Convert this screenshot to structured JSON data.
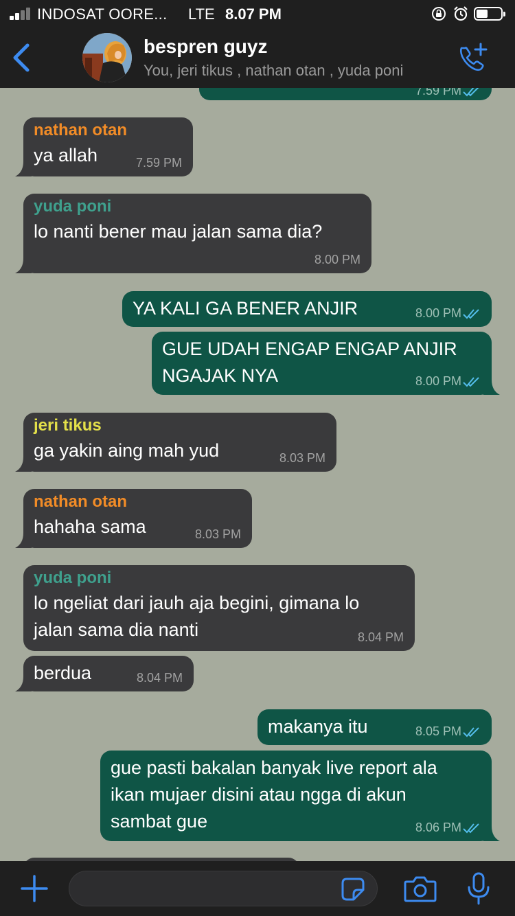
{
  "status_bar": {
    "carrier": "INDOSAT OORE...",
    "network": "LTE",
    "time": "8.07 PM"
  },
  "header": {
    "title": "bespren guyz",
    "subtitle": "You, jeri tikus , nathan otan , yuda poni"
  },
  "colors": {
    "nathan_otan": "#f28c27",
    "yuda_poni": "#3fa08d",
    "jeri_tikus": "#e3e04a",
    "incoming_bubble": "#3a3a3c",
    "outgoing_bubble": "#0f5546",
    "accent_blue": "#3d8bf0"
  },
  "messages": [
    {
      "sender": "",
      "text": "",
      "time": "7.59 PM",
      "outgoing": true,
      "partial": true
    },
    {
      "sender": "nathan otan",
      "text": "ya allah",
      "time": "7.59 PM",
      "outgoing": false
    },
    {
      "sender": "yuda poni",
      "text": "lo nanti bener mau jalan sama dia?",
      "time": "8.00 PM",
      "outgoing": false
    },
    {
      "sender": "",
      "text": "YA KALI GA BENER ANJIR",
      "time": "8.00 PM",
      "outgoing": true
    },
    {
      "sender": "",
      "text": "GUE UDAH ENGAP ENGAP ANJIR\nNGAJAK NYA",
      "time": "8.00 PM",
      "outgoing": true
    },
    {
      "sender": "jeri tikus",
      "text": "ga yakin aing mah yud",
      "time": "8.03 PM",
      "outgoing": false
    },
    {
      "sender": "nathan otan",
      "text": "hahaha sama",
      "time": "8.03 PM",
      "outgoing": false
    },
    {
      "sender": "yuda poni",
      "text": "lo ngeliat dari jauh aja begini, gimana lo\njalan sama dia nanti",
      "time": "8.04 PM",
      "outgoing": false
    },
    {
      "sender": "",
      "text": "berdua",
      "time": "8.04 PM",
      "outgoing": false
    },
    {
      "sender": "",
      "text": "makanya itu",
      "time": "8.05 PM",
      "outgoing": true
    },
    {
      "sender": "",
      "text": "gue pasti bakalan banyak live report ala\nikan mujaer disini atau ngga di akun\nsambat gue",
      "time": "8.06 PM",
      "outgoing": true
    }
  ],
  "composer": {
    "placeholder": "",
    "value": ""
  },
  "icons": {
    "back": "chevron-left-icon",
    "call_add": "phone-plus-icon",
    "attach": "plus-icon",
    "sticker": "sticker-icon",
    "camera": "camera-icon",
    "mic": "microphone-icon"
  }
}
